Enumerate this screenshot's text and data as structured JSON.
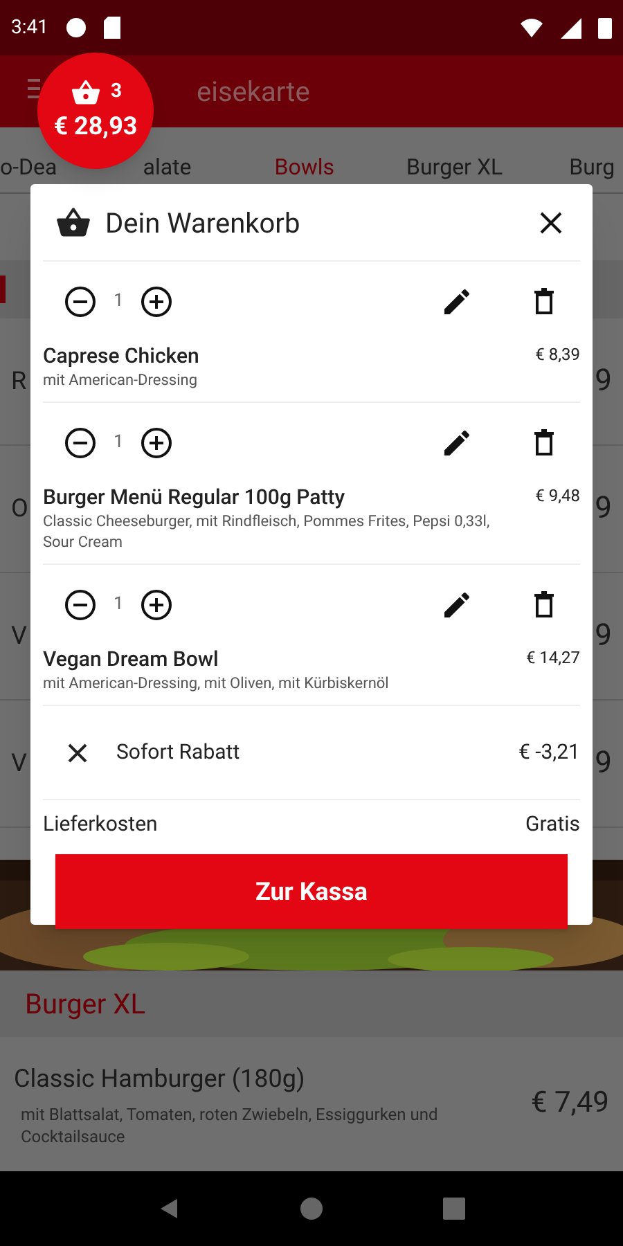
{
  "status_bar": {
    "time": "3:41"
  },
  "app_bar": {
    "title": "eisekarte"
  },
  "cart_bubble": {
    "count": "3",
    "total": "€ 28,93"
  },
  "tabs": [
    {
      "label": "o-Dea",
      "selected": false
    },
    {
      "label": "alate",
      "selected": false
    },
    {
      "label": "Bowls",
      "selected": true
    },
    {
      "label": "Burger XL",
      "selected": false
    },
    {
      "label": "Burg",
      "selected": false
    }
  ],
  "menu_items": [
    {
      "name": "R",
      "price": "9"
    },
    {
      "name": "O",
      "price": "9"
    },
    {
      "name": "V",
      "price": "9"
    },
    {
      "name": "V",
      "price": "9"
    }
  ],
  "section": {
    "title": "Burger XL"
  },
  "section_item": {
    "name": "Classic Hamburger (180g)",
    "description": "mit Blattsalat, Tomaten, roten Zwiebeln, Essiggurken und Cocktailsauce",
    "price": "€ 7,49"
  },
  "cart": {
    "title": "Dein Warenkorb",
    "items": [
      {
        "quantity": "1",
        "name": "Caprese Chicken",
        "price": "€ 8,39",
        "description": "mit American-Dressing"
      },
      {
        "quantity": "1",
        "name": "Burger Menü Regular 100g Patty",
        "price": "€ 9,48",
        "description": "Classic Cheeseburger, mit  Rindfleisch, Pommes Frites, Pepsi 0,33l, Sour Cream"
      },
      {
        "quantity": "1",
        "name": "Vegan Dream Bowl",
        "price": "€ 14,27",
        "description": "mit American-Dressing, mit Oliven, mit Kürbiskernöl"
      }
    ],
    "discount": {
      "label": "Sofort Rabatt",
      "amount": "€ -3,21"
    },
    "delivery": {
      "label": "Lieferkosten",
      "value": "Gratis"
    },
    "checkout_button": "Zur Kassa"
  }
}
